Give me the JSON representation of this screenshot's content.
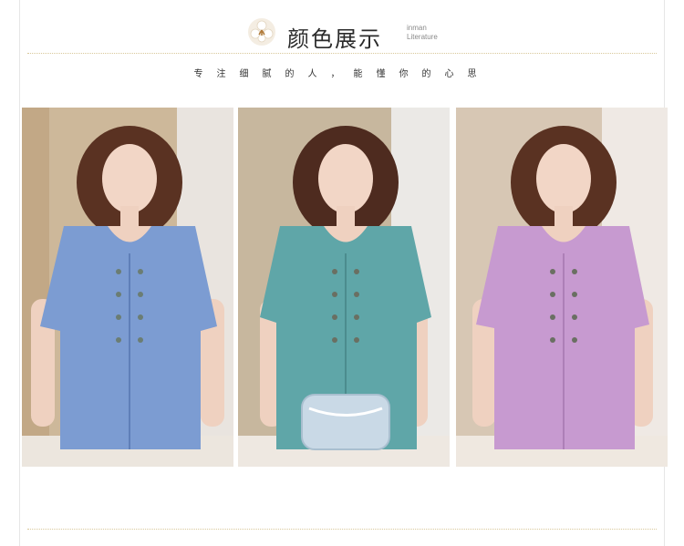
{
  "header": {
    "title": "颜色展示",
    "brand_line1": "inman",
    "brand_line2": "Literature",
    "logo_icon": "cotton-flower-icon"
  },
  "subtitle": "专注细腻的人，能懂你的心思",
  "photos": [
    {
      "color_name": "blue",
      "shirt_hex": "#7c9cd2",
      "bg_hex": "#cdb89a"
    },
    {
      "color_name": "teal",
      "shirt_hex": "#5fa6a8",
      "bg_hex": "#c7b79e"
    },
    {
      "color_name": "pink",
      "shirt_hex": "#c79ad0",
      "bg_hex": "#d7c7b4"
    }
  ]
}
